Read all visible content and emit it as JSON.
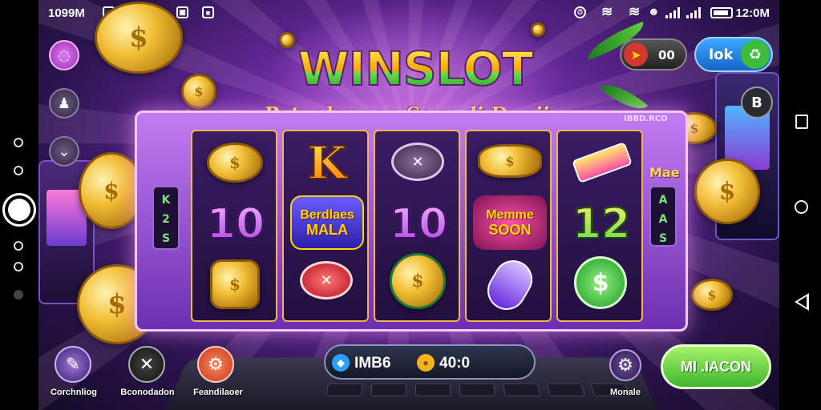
{
  "status_bar": {
    "left_time": "1099M",
    "clock": "12:0M",
    "icons": [
      "app-icon",
      "photo-icon",
      "sync-icon",
      "image-icon",
      "record-icon",
      "alarm-icon",
      "wifi-icon",
      "wifi-icon-2",
      "user-icon",
      "signal-icon",
      "signal-icon-2",
      "battery-icon"
    ]
  },
  "title": "WINSLOT",
  "subtitle": "Petualangan Seru di Dunija Slot",
  "frame_label": "IBBD.RCO",
  "top_right": {
    "score_value": "00",
    "ok_label": "lok"
  },
  "left_strip": [
    "K",
    "2",
    "S"
  ],
  "right_strip": [
    "A",
    "A",
    "S"
  ],
  "right_strip_top": "Mae",
  "reels": [
    {
      "symbols": [
        "gold-coin",
        "",
        "gold-bell"
      ],
      "number": "10"
    },
    {
      "symbols": [
        "K",
        "Berdlaes MALA",
        "red-chip"
      ]
    },
    {
      "symbols": [
        "dark-chip",
        "10",
        "roulette-coin"
      ]
    },
    {
      "symbols": [
        "gold-stack",
        "Memme SOON",
        "rocket"
      ]
    },
    {
      "symbols": [
        "gold-bar",
        "12",
        "green-dollar-coin"
      ]
    }
  ],
  "reel_texts": {
    "r2_badge_line1": "Berdlaes",
    "r2_badge_line2": "MALA",
    "r4_badge_line1": "Memme",
    "r4_badge_line2": "SOON"
  },
  "bottom": {
    "btn1_label": "Corchnliog",
    "btn2_label": "Bconodadon",
    "btn3_label": "Feandilaoer",
    "btn4_label": "Monale",
    "balance_left": "IMB6",
    "balance_right": "40:0",
    "spin_label": "MI .IACON"
  },
  "colors": {
    "accent_purple": "#9a2fb6",
    "spin_green": "#3fb52c",
    "gold": "#f2be36"
  }
}
